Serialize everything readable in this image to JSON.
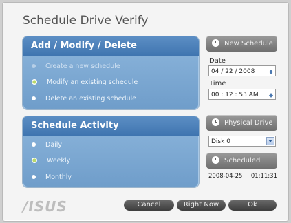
{
  "title": "Schedule Drive Verify",
  "add_panel": {
    "header": "Add / Modify / Delete",
    "options": [
      {
        "label": "Create a new schedule",
        "selected": false,
        "enabled": false
      },
      {
        "label": "Modify an existing schedule",
        "selected": true,
        "enabled": true
      },
      {
        "label": "Delete an existing schedule",
        "selected": false,
        "enabled": true
      }
    ]
  },
  "activity_panel": {
    "header": "Schedule Activity",
    "options": [
      {
        "label": "Daily",
        "selected": false
      },
      {
        "label": "Weekly",
        "selected": true
      },
      {
        "label": "Monthly",
        "selected": false
      }
    ]
  },
  "right": {
    "new_schedule_label": "New Schedule",
    "date_label": "Date",
    "date_value": "04 / 22 / 2008",
    "time_label": "Time",
    "time_value": "00 : 12 : 53 AM",
    "physical_drive_label": "Physical Drive",
    "drive_value": "Disk 0",
    "scheduled_label": "Scheduled",
    "scheduled_date": "2008-04-25",
    "scheduled_time": "01:11:31"
  },
  "footer": {
    "logo": "/ISUS",
    "cancel": "Cancel",
    "right_now": "Right Now",
    "ok": "Ok"
  },
  "colors": {
    "panel": "#7aa6d3",
    "header": "#4a7fba",
    "button": "#8a8a8a"
  }
}
